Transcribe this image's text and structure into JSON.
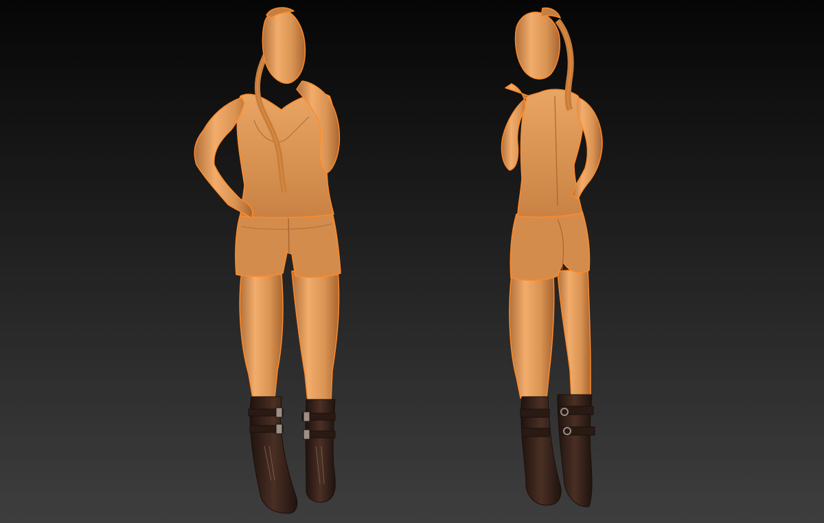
{
  "scene": {
    "type": "3d-sculpt-render",
    "views": [
      "front",
      "back"
    ],
    "colors": {
      "background_top": "#060606",
      "background_bottom": "#3e3e3e",
      "skin_light": "#f2ad6c",
      "skin_mid": "#d99353",
      "skin_dark": "#b2703a",
      "rim": "#ff8a2a",
      "boot_dark": "#2a1a14",
      "boot_mid": "#4a2f24",
      "boot_light": "#7a5a48",
      "buckle": "#9c8f86"
    }
  }
}
